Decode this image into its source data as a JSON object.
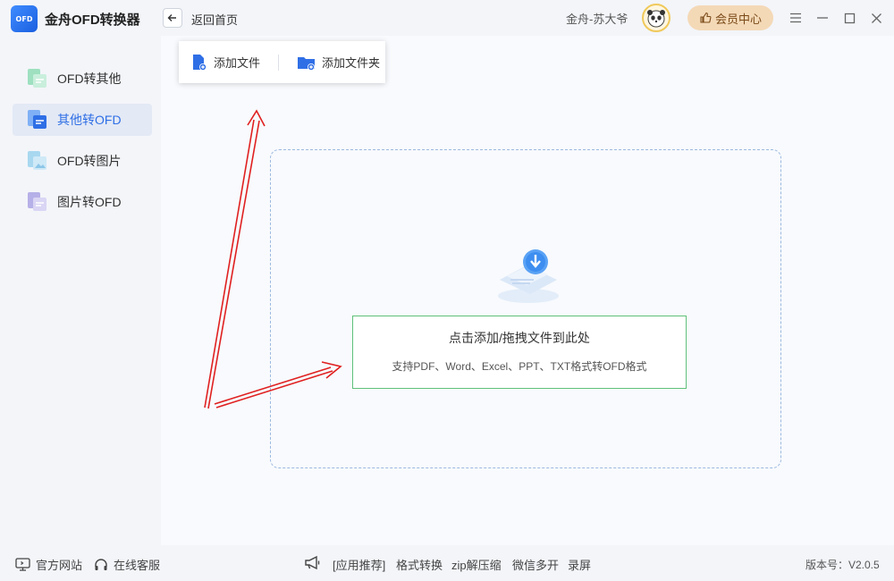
{
  "app": {
    "title": "金舟OFD转换器",
    "logo_text": "OFD"
  },
  "header": {
    "back_label": "返回首页",
    "username": "金舟-苏大爷",
    "vip_label": "会员中心"
  },
  "sidebar": {
    "items": [
      {
        "label": "OFD转其他",
        "active": false
      },
      {
        "label": "其他转OFD",
        "active": true
      },
      {
        "label": "OFD转图片",
        "active": false
      },
      {
        "label": "图片转OFD",
        "active": false
      }
    ]
  },
  "toolbar": {
    "add_file_label": "添加文件",
    "add_folder_label": "添加文件夹"
  },
  "dropzone": {
    "title": "点击添加/拖拽文件到此处",
    "hint": "支持PDF、Word、Excel、PPT、TXT格式转OFD格式"
  },
  "footer": {
    "website_label": "官方网站",
    "support_label": "在线客服",
    "recommend_label": "[应用推荐]",
    "links": [
      "格式转换",
      "zip解压缩",
      "微信多开",
      "录屏"
    ],
    "version": "版本号：V2.0.5"
  },
  "colors": {
    "accent": "#2f6fe6",
    "vip_bg": "#f4d9b7",
    "drop_border": "#5fc07a",
    "arrow": "#e02020"
  }
}
